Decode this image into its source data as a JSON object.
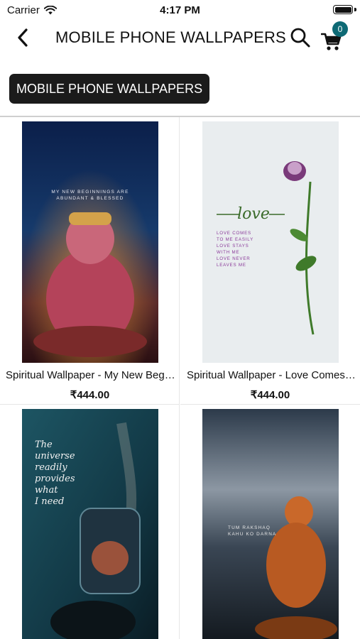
{
  "status_bar": {
    "carrier": "Carrier",
    "time": "4:17 PM"
  },
  "nav": {
    "title": "MOBILE PHONE WALLPAPERS",
    "cart_count": "0"
  },
  "category_chip": {
    "label": "MOBILE PHONE WALLPAPERS"
  },
  "products": [
    {
      "name": "Spiritual Wallpaper - My New Beginnings Are Abundant & Blessed",
      "price": "₹444.00",
      "image_text": [
        "MY NEW BEGINNINGS ARE",
        "ABUNDANT & BLESSED"
      ]
    },
    {
      "name": "Spiritual Wallpaper - Love Comes to Me Easily",
      "price": "₹444.00",
      "image_text": [
        "love",
        "LOVE COMES",
        "TO ME EASILY",
        "LOVE STAYS",
        "WITH ME",
        "LOVE NEVER",
        "LEAVES ME"
      ]
    },
    {
      "name": "",
      "price": "",
      "image_text": [
        "The",
        "universe",
        "readily",
        "provides",
        "what",
        "I need"
      ]
    },
    {
      "name": "",
      "price": "",
      "image_text": [
        "TUM RAKSHAQ",
        "KAHU KO DARNA"
      ]
    }
  ],
  "icons": {
    "back": "chevron-left-icon",
    "search": "search-icon",
    "cart": "cart-icon",
    "wifi": "wifi-icon",
    "battery": "battery-icon"
  },
  "colors": {
    "badge": "#0e6a75",
    "chip_bg": "#1b1b1b"
  }
}
